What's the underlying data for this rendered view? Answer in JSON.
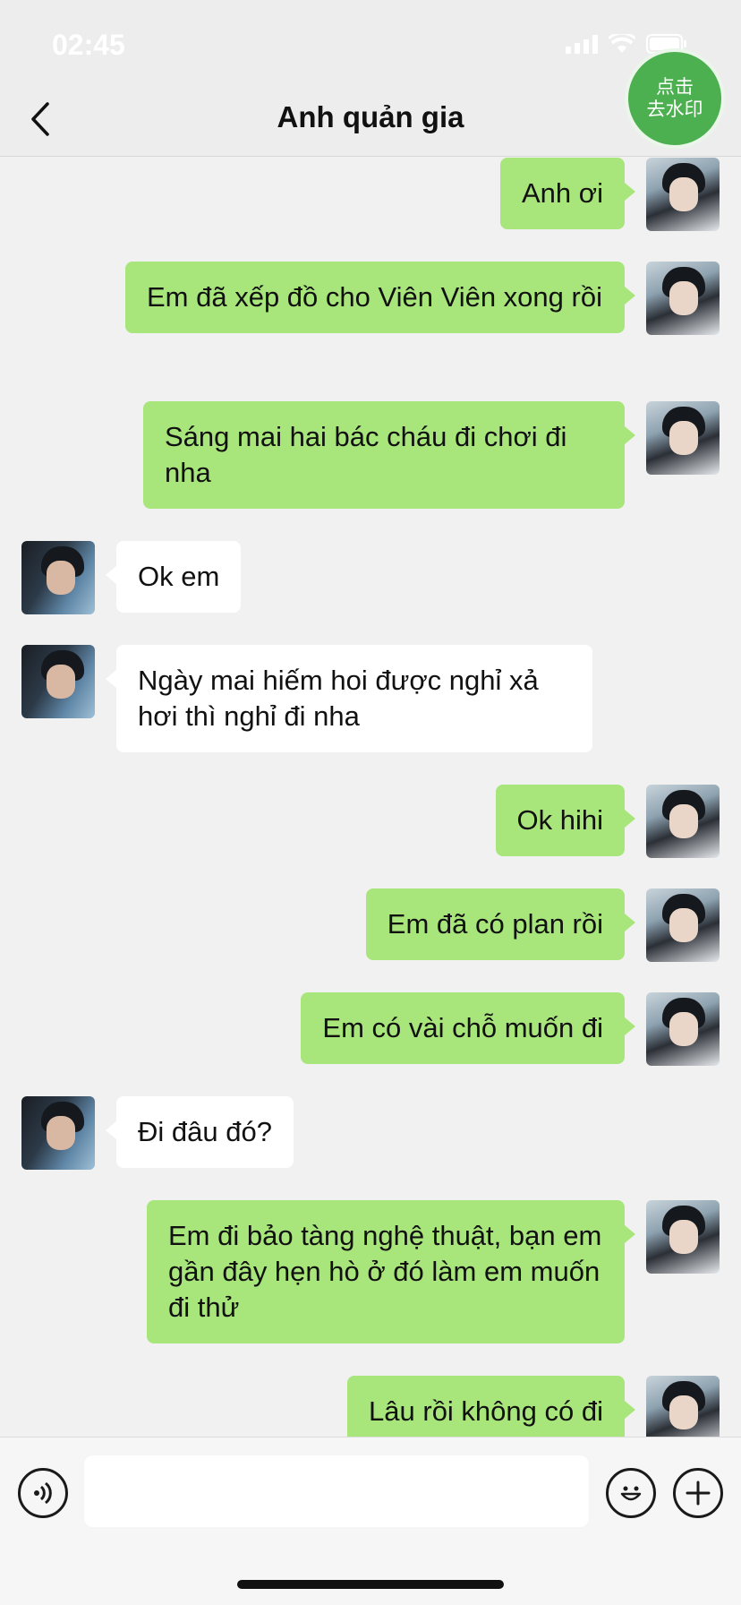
{
  "status_bar": {
    "time": "02:45"
  },
  "nav": {
    "title": "Anh quản gia"
  },
  "watermark_badge": {
    "line1": "点击",
    "line2": "去水印"
  },
  "messages": [
    {
      "sender": "me",
      "text": "Anh ơi"
    },
    {
      "sender": "me",
      "text": "Em đã xếp đồ cho Viên Viên xong rồi"
    },
    {
      "sender": "me",
      "text": "Sáng mai hai bác cháu đi chơi đi nha"
    },
    {
      "sender": "them",
      "text": "Ok em"
    },
    {
      "sender": "them",
      "text": "Ngày mai hiếm hoi được nghỉ xả hơi thì nghỉ đi nha"
    },
    {
      "sender": "me",
      "text": "Ok hihi"
    },
    {
      "sender": "me",
      "text": "Em đã có plan rồi"
    },
    {
      "sender": "me",
      "text": "Em có vài chỗ muốn đi"
    },
    {
      "sender": "them",
      "text": "Đi đâu đó?"
    },
    {
      "sender": "me",
      "text": "Em đi bảo tàng nghệ thuật, bạn em gần đây hẹn hò ở đó làm em muốn đi thử"
    },
    {
      "sender": "me",
      "text": "Lâu rồi không có đi"
    }
  ],
  "input_bar": {
    "value": "",
    "voice_icon": "voice-icon",
    "emoji_icon": "emoji-icon",
    "plus_icon": "plus-icon"
  },
  "colors": {
    "my_bubble": "#a8e67c",
    "their_bubble": "#ffffff",
    "badge": "#4caf50",
    "background": "#f1f1f1"
  }
}
